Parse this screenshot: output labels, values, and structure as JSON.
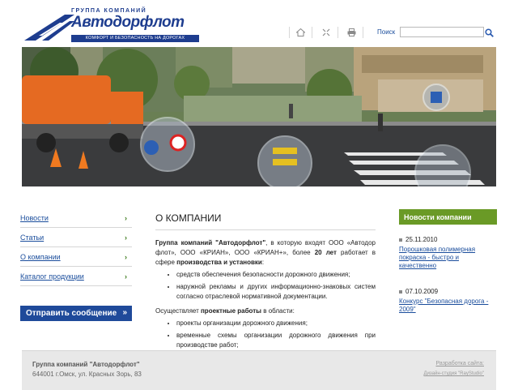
{
  "header": {
    "logo_group": "ГРУППА КОМПАНИЙ",
    "logo_name": "Автодорфлот",
    "logo_tagline": "КОМФОРТ И БЕЗОПАСНОСТЬ НА ДОРОГАХ",
    "search_label": "Поиск",
    "search_value": ""
  },
  "menu": {
    "items": [
      {
        "label": "Новости"
      },
      {
        "label": "Статьи"
      },
      {
        "label": "О компании"
      },
      {
        "label": "Каталог продукции"
      }
    ],
    "send_button": "Отправить сообщение"
  },
  "main": {
    "title": "О КОМПАНИИ",
    "intro": {
      "p1": "Группа компаний \"Автодорфлот\"",
      "p2": ", в которую входят ООО «Автодор флот», ООО «КРИАН», ООО «КРИАН+», более ",
      "p3": "20 лет",
      "p4": " работает в сфере ",
      "p5": "производства и установки",
      "p6": ":"
    },
    "list1": [
      "средств обеспечения безопасности дорожного движения;",
      "наружной рекламы и других информационно-знаковых систем согласно отраслевой нормативной документации."
    ],
    "projects_intro": {
      "a": "Осуществляет ",
      "b": "проектные работы",
      "c": " в области:"
    },
    "list2": [
      "проекты организации дорожного движения;",
      "временные схемы организации дорожного движения при производстве работ;"
    ]
  },
  "news": {
    "header": "Новости компании",
    "items": [
      {
        "date": "25.11.2010",
        "title": "Порошковая полимерная покраска - быстро и качественно"
      },
      {
        "date": "07.10.2009",
        "title": "Конкурс \"Безопасная дорога - 2009\""
      }
    ]
  },
  "footer": {
    "company": "Группа компаний \"Автодорфлот\"",
    "address": "644001 г.Омск, ул. Красных Зорь, 83",
    "dev_label": "Разработка сайта:",
    "studio": "Дизайн-студия \"RayStudio\""
  },
  "colors": {
    "brand_blue": "#1e3d8f",
    "news_green": "#6a9a26",
    "link": "#1a4d9c"
  },
  "icons": [
    "home-icon",
    "sitemap-icon",
    "print-icon",
    "search-icon",
    "chevron-right-icon"
  ]
}
